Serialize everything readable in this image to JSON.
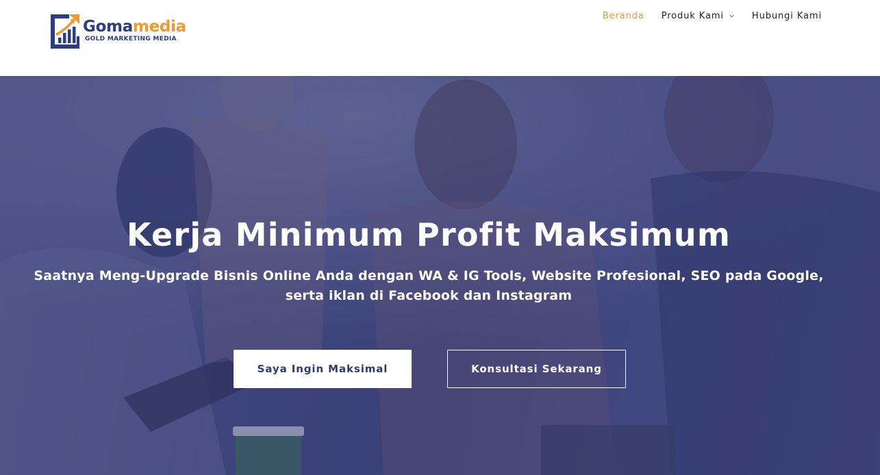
{
  "header": {
    "logo": {
      "name_part1": "Goma",
      "name_part2": "media",
      "tagline": "GOLD MARKETING MEDIA",
      "colors": {
        "primary": "#2a3d86",
        "accent": "#f29a2e"
      }
    },
    "nav": {
      "items": [
        {
          "label": "Beranda",
          "active": true
        },
        {
          "label": "Produk Kami",
          "has_dropdown": true
        },
        {
          "label": "Hubungi Kami"
        }
      ],
      "active_color": "#e09a3e"
    }
  },
  "hero": {
    "title": "Kerja Minimum Profit Maksimum",
    "subtitle": "Saatnya Meng-Upgrade Bisnis Online Anda dengan WA & IG Tools, Website Profesional, SEO pada Google, serta iklan di Facebook dan Instagram",
    "primary_button": "Saya Ingin Maksimal",
    "secondary_button": "Konsultasi Sekarang",
    "overlay_color": "#303773",
    "background_icon": "team-photo"
  }
}
